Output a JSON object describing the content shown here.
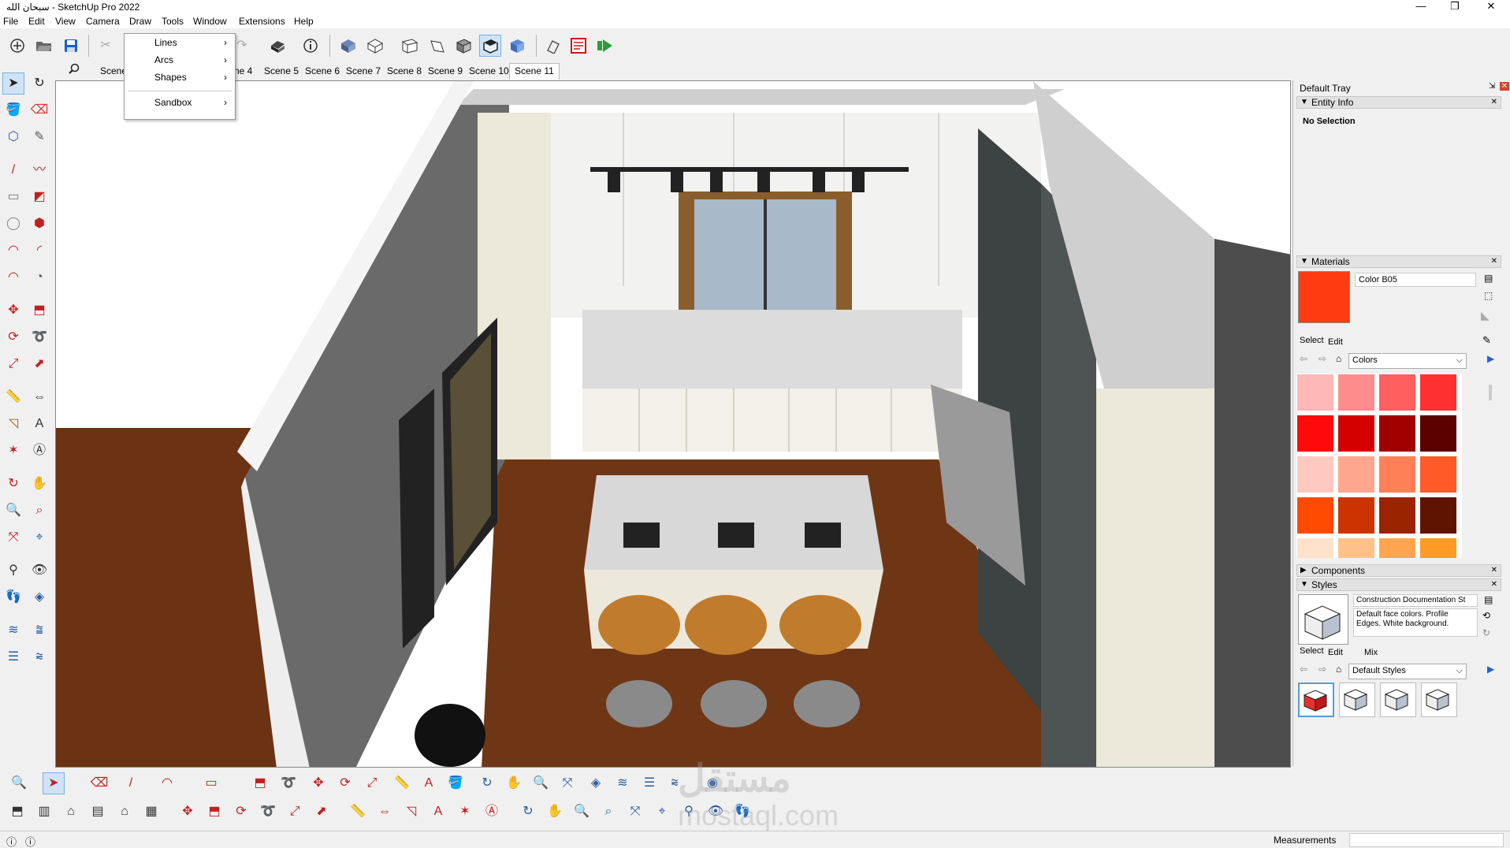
{
  "window": {
    "title": "سبحان الله - SketchUp Pro 2022",
    "minimize": "—",
    "maximize": "❐",
    "close": "✕"
  },
  "menus": [
    "File",
    "Edit",
    "View",
    "Camera",
    "Draw",
    "Tools",
    "Window",
    "Extensions",
    "Help"
  ],
  "draw_menu": {
    "items": [
      {
        "label": "Lines",
        "arrow": "›"
      },
      {
        "label": "Arcs",
        "arrow": "›"
      },
      {
        "label": "Shapes",
        "arrow": "›"
      },
      {
        "label": "Sandbox",
        "arrow": "›"
      }
    ]
  },
  "scenes": {
    "partial_first": "Scene",
    "partial_second": "ne 4",
    "tabs": [
      "Scene 5",
      "Scene 6",
      "Scene 7",
      "Scene 8",
      "Scene 9",
      "Scene 10"
    ],
    "active": "Scene 11"
  },
  "top_toolbar": [
    "new-icon",
    "open-icon",
    "save-icon",
    "cut-icon",
    "copy-icon",
    "paste-icon",
    "undo-icon",
    "redo-icon",
    "print-icon",
    "model-info-icon",
    "iso-view-icon",
    "top-view-icon",
    "front-view-icon",
    "right-view-icon",
    "back-view-icon",
    "left-view-icon",
    "bottom-view-icon",
    "section-plane-icon",
    "layout-icon",
    "send-to-layout-icon"
  ],
  "left_tools": [
    "select-icon",
    "orbit-icon",
    "paint-bucket-icon",
    "eraser-icon",
    "make-component-icon",
    "tag-tool-icon",
    "line-icon",
    "freehand-icon",
    "rectangle-icon",
    "rotated-rectangle-icon",
    "circle-icon",
    "polygon-icon",
    "arc-icon",
    "two-point-arc-icon",
    "three-point-arc-icon",
    "pie-icon",
    "move-icon",
    "push-pull-icon",
    "rotate-icon",
    "follow-me-icon",
    "scale-icon",
    "offset-icon",
    "tape-measure-icon",
    "dimension-icon",
    "protractor-icon",
    "text-icon",
    "axes-icon",
    "3d-text-icon",
    "orbit-tool-icon",
    "pan-icon",
    "zoom-icon",
    "zoom-window-icon",
    "zoom-extents-icon",
    "previous-view-icon",
    "position-camera-icon",
    "look-around-icon",
    "walk-icon",
    "section-icon",
    "sandbox-smoove-icon",
    "sandbox-stamp-icon",
    "sandbox-drape-icon",
    "sandbox-flip-icon"
  ],
  "glyphs": {
    "select": "➤",
    "orbit": "↻",
    "paint": "🪣",
    "eraser": "⌫",
    "line": "/",
    "rect": "▭",
    "circle": "◯",
    "arc": "◠",
    "move": "✥",
    "pushpull": "⬒",
    "rotate": "⟳",
    "scale": "⤢",
    "tape": "📏",
    "text": "A",
    "axes": "✶",
    "pan": "✋",
    "zoom": "🔍",
    "zoomext": "⤧",
    "walk": "👣",
    "section": "◈",
    "sandbox": "≋",
    "help": "?",
    "info": "ⓘ"
  },
  "tray": {
    "title": "Default Tray",
    "pin": "⇲",
    "close": "✕",
    "entity_info": {
      "title": "Entity Info",
      "value": "No Selection"
    },
    "materials": {
      "title": "Materials",
      "current_name": "Color B05",
      "current_color": "#ff3b12",
      "select_tab": "Select",
      "edit_tab": "Edit",
      "library": "Colors",
      "swatches": [
        "#ffb8b8",
        "#ff8c8c",
        "#ff5f5f",
        "#ff3030",
        "#ff0a0a",
        "#d40000",
        "#a00000",
        "#5c0000",
        "#ffc9c0",
        "#ffa68e",
        "#ff7f57",
        "#ff5a28",
        "#ff4a00",
        "#cc3300",
        "#9a2400",
        "#5e1400",
        "#ffe2cc",
        "#ffc189",
        "#ffa550",
        "#ff9a22"
      ]
    },
    "components": {
      "title": "Components"
    },
    "styles": {
      "title": "Styles",
      "style_name": "Construction Documentation St",
      "description": "Default face colors. Profile Edges. White background.",
      "select_tab": "Select",
      "edit_tab": "Edit",
      "mix_tab": "Mix",
      "library": "Default Styles"
    }
  },
  "status": {
    "measurements_label": "Measurements",
    "measurements_value": ""
  },
  "watermark": {
    "text_ar": "مستقل",
    "text_en": "mostaql.com"
  }
}
